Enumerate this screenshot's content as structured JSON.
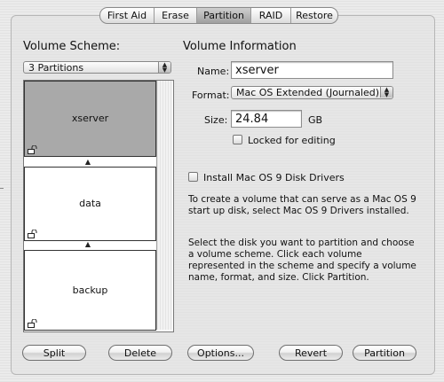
{
  "tabs": [
    {
      "label": "First Aid",
      "selected": false
    },
    {
      "label": "Erase",
      "selected": false
    },
    {
      "label": "Partition",
      "selected": true
    },
    {
      "label": "RAID",
      "selected": false
    },
    {
      "label": "Restore",
      "selected": false
    }
  ],
  "volume_scheme": {
    "heading": "Volume Scheme:",
    "selected_scheme": "3 Partitions",
    "partitions": [
      {
        "name": "xserver",
        "selected": true,
        "locked_icon": "lock-open-icon"
      },
      {
        "name": "data",
        "selected": false,
        "locked_icon": "lock-open-icon"
      },
      {
        "name": "backup",
        "selected": false,
        "locked_icon": "lock-open-icon"
      }
    ]
  },
  "volume_information": {
    "heading": "Volume Information",
    "name_label": "Name:",
    "name_value": "xserver",
    "format_label": "Format:",
    "format_value": "Mac OS Extended (Journaled)",
    "size_label": "Size:",
    "size_value": "24.84",
    "size_unit": "GB",
    "locked_label": "Locked for editing",
    "locked_checked": false,
    "os9_label": "Install Mac OS 9 Disk Drivers",
    "os9_checked": false,
    "os9_help": "To create a volume that can serve as a Mac OS 9 start up disk, select Mac OS 9 Drivers installed.",
    "instructions": "Select the disk you want to partition and choose a volume scheme. Click each volume represented in the scheme and specify a volume name, format, and size. Click Partition."
  },
  "buttons": {
    "split": "Split",
    "delete": "Delete",
    "options": "Options...",
    "revert": "Revert",
    "partition": "Partition"
  },
  "colors": {
    "selected_partition": "#a9a9a9",
    "window_background": "#e6e6e6"
  }
}
